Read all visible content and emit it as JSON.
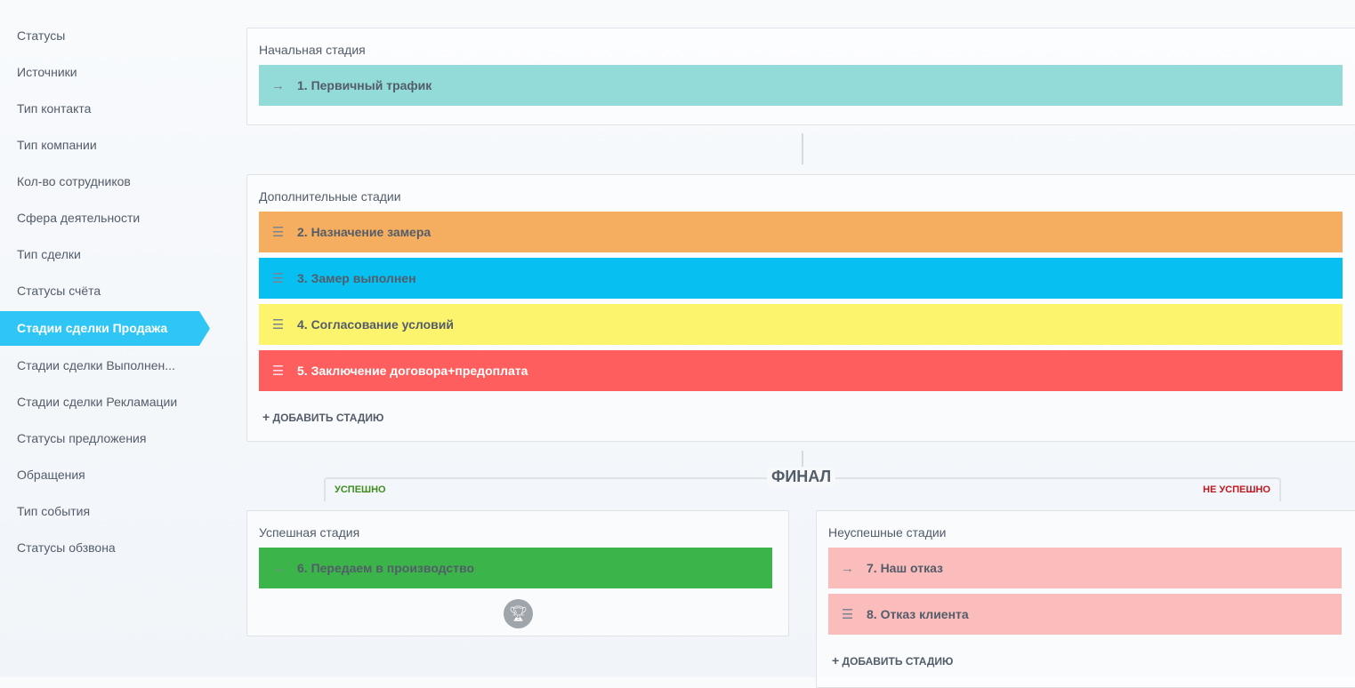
{
  "sidebar": {
    "items": [
      {
        "label": "Статусы"
      },
      {
        "label": "Источники"
      },
      {
        "label": "Тип контакта"
      },
      {
        "label": "Тип компании"
      },
      {
        "label": "Кол-во сотрудников"
      },
      {
        "label": "Сфера деятельности"
      },
      {
        "label": "Тип сделки"
      },
      {
        "label": "Статусы счёта"
      },
      {
        "label": "Стадии сделки Продажа",
        "active": true
      },
      {
        "label": "Стадии сделки Выполнен..."
      },
      {
        "label": "Стадии сделки Рекламации"
      },
      {
        "label": "Статусы предложения"
      },
      {
        "label": "Обращения"
      },
      {
        "label": "Тип события"
      },
      {
        "label": "Статусы обзвона"
      }
    ]
  },
  "initial": {
    "title": "Начальная стадия",
    "stages": [
      {
        "label": "1. Первичный трафик",
        "color": "#93dbd8",
        "icon": "arrow-right-icon"
      }
    ]
  },
  "extra": {
    "title": "Дополнительные стадии",
    "add_label": "ДОБАВИТЬ СТАДИЮ",
    "stages": [
      {
        "label": "2. Назначение замера",
        "color": "#f5ad5f",
        "icon": "drag-handle-icon"
      },
      {
        "label": "3. Замер выполнен",
        "color": "#07bff0",
        "icon": "drag-handle-icon"
      },
      {
        "label": "4. Согласование условий",
        "color": "#fdf46d",
        "icon": "drag-handle-icon"
      },
      {
        "label": "5. Заключение договора+предоплата",
        "color": "#ff5e5e",
        "icon": "drag-handle-icon"
      }
    ]
  },
  "final": {
    "title": "ФИНАЛ",
    "success_label": "УСПЕШНО",
    "fail_label": "НЕ УСПЕШНО"
  },
  "success": {
    "title": "Успешная стадия",
    "stages": [
      {
        "label": "6. Передаем в производство",
        "color": "#3bb54a",
        "icon": "arrow-right-icon"
      }
    ]
  },
  "fail": {
    "title": "Неуспешные стадии",
    "add_label": "ДОБАВИТЬ СТАДИЮ",
    "stages": [
      {
        "label": "7. Наш отказ",
        "color": "#fbbcbc",
        "icon": "arrow-right-icon"
      },
      {
        "label": "8. Отказ клиента",
        "color": "#fbbcbc",
        "icon": "drag-handle-icon"
      }
    ]
  }
}
